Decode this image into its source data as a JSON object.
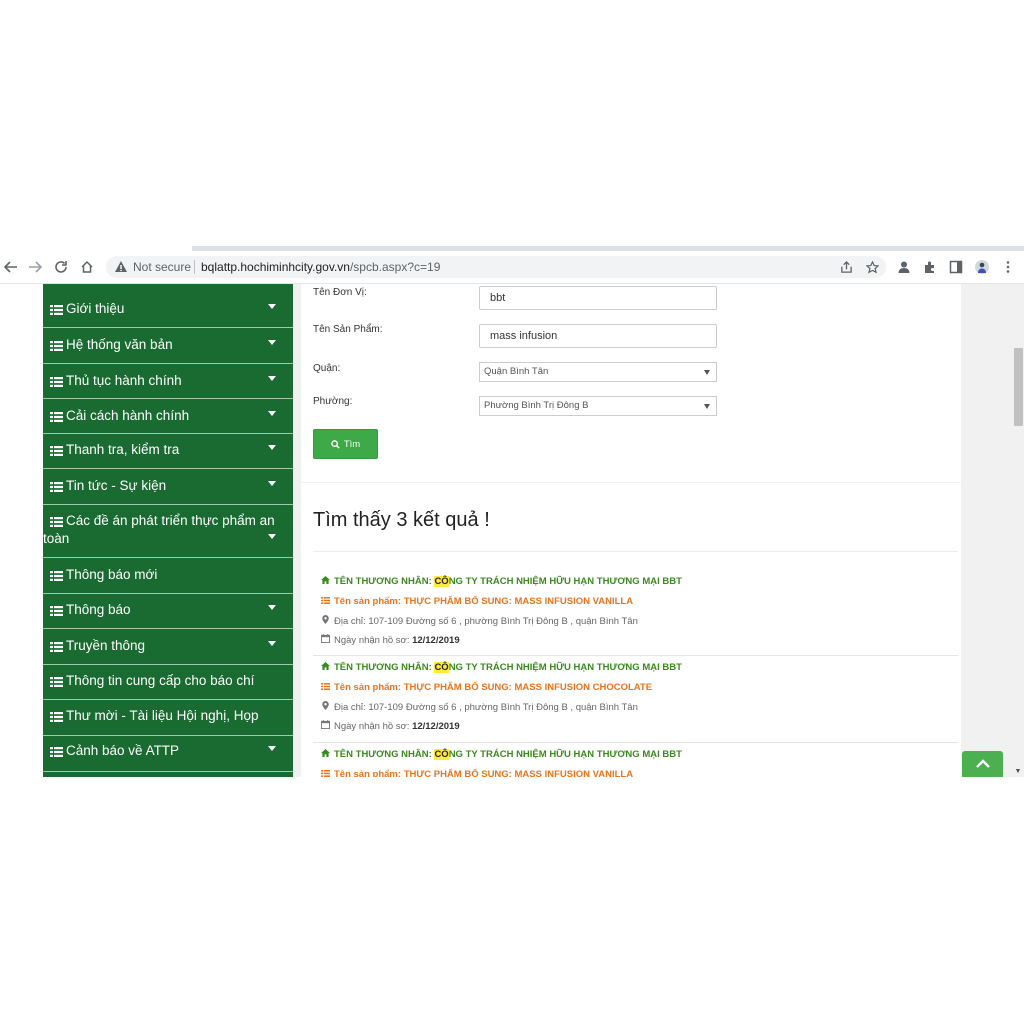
{
  "browser": {
    "security_label": "Not secure",
    "url_host": "bqlattp.hochiminhcity.gov.vn",
    "url_path": "/spcb.aspx?c=19"
  },
  "sidebar": {
    "items": [
      {
        "label": "Giới thiệu",
        "has_submenu": true
      },
      {
        "label": "Hệ thống văn bản",
        "has_submenu": true
      },
      {
        "label": "Thủ tục hành chính",
        "has_submenu": true
      },
      {
        "label": "Cải cách hành chính",
        "has_submenu": true
      },
      {
        "label": "Thanh tra, kiểm tra",
        "has_submenu": true
      },
      {
        "label": "Tin tức - Sự kiện",
        "has_submenu": true
      },
      {
        "label_line1": "Các đề án phát triển thực phẩm an",
        "label_line2": "toàn",
        "has_submenu": true
      },
      {
        "label": "Thông báo mới",
        "has_submenu": false
      },
      {
        "label": "Thông báo",
        "has_submenu": true
      },
      {
        "label": "Truyền thông",
        "has_submenu": true
      },
      {
        "label": "Thông tin cung cấp cho báo chí",
        "has_submenu": false
      },
      {
        "label": "Thư mời - Tài liệu Hội nghị, Họp",
        "has_submenu": false
      },
      {
        "label": "Cảnh báo về ATTP",
        "has_submenu": true
      }
    ]
  },
  "form": {
    "unit_label": "Tên Đơn Vị:",
    "unit_value": "bbt",
    "product_label": "Tên Sản Phẩm:",
    "product_value": "mass infusion",
    "district_label": "Quận:",
    "district_value": "Quận Bình Tân",
    "ward_label": "Phường:",
    "ward_value": "Phường Bình Trị Đông B",
    "search_label": "Tìm"
  },
  "results": {
    "title": "Tìm thấy 3 kết quả !",
    "merchant_prefix": "TÊN THƯƠNG NHÂN: ",
    "product_prefix": "Tên sản phẩm: ",
    "address_prefix": "Địa chỉ: ",
    "date_prefix": "Ngày nhận hồ sơ: ",
    "items": [
      {
        "merchant_highlight": "CÔ",
        "merchant_rest": "NG TY TRÁCH NHIỆM HỮU HẠN THƯƠNG MẠI BBT",
        "product": "THỰC PHẨM BỔ SUNG: MASS INFUSION VANILLA",
        "address": "107-109 Đường số 6 , phường Bình Trị Đông B , quận Bình Tân",
        "date": "12/12/2019"
      },
      {
        "merchant_highlight": "CÔ",
        "merchant_rest": "NG TY TRÁCH NHIỆM HỮU HẠN THƯƠNG MẠI BBT",
        "product": "THỰC PHẨM BỔ SUNG: MASS INFUSION CHOCOLATE",
        "address": "107-109 Đường số 6 , phường Bình Trị Đông B , quận Bình Tân",
        "date": "12/12/2019"
      },
      {
        "merchant_highlight": "CÔ",
        "merchant_rest": "NG TY TRÁCH NHIỆM HỮU HẠN THƯƠNG MẠI BBT",
        "product": "THỰC PHẨM BỔ SUNG: MASS INFUSION VANILLA"
      }
    ]
  },
  "colors": {
    "sidebar_bg": "#1a6b31",
    "merchant_green": "#3a8a1e",
    "product_orange": "#e8741c",
    "button_green": "#3daa47",
    "highlight_yellow": "#ffeb3b"
  },
  "icons": [
    "back-arrow-icon",
    "forward-arrow-icon",
    "reload-icon",
    "home-icon",
    "warning-icon",
    "share-icon",
    "star-icon",
    "profile-icon",
    "extensions-icon",
    "side-panel-icon",
    "avatar",
    "kebab-menu-icon",
    "list-icon",
    "caret-down-icon",
    "search-icon",
    "home-icon",
    "list-icon",
    "map-marker-icon",
    "calendar-icon",
    "chevron-up-icon"
  ]
}
